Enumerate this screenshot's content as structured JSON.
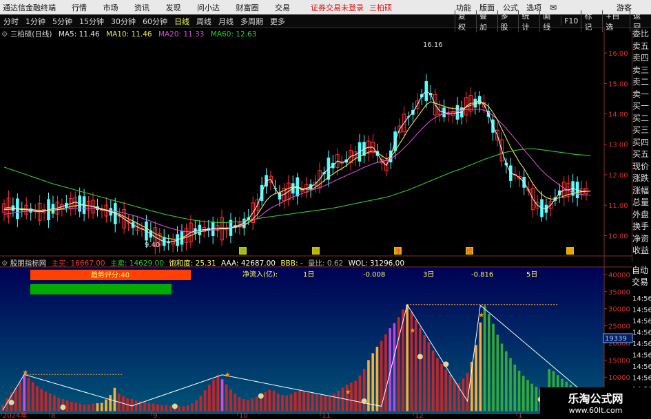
{
  "titlebar": {
    "app": "通达信金融终端",
    "menu": [
      "行情",
      "市场",
      "资讯",
      "发现",
      "问小达",
      "财富圈",
      "交易"
    ],
    "warn": "证券交易未登录",
    "stock_name": "三柏硕",
    "rmenu": [
      "功能",
      "版面",
      "公式",
      "选项"
    ],
    "guest": "游客"
  },
  "toolbar": {
    "periods": [
      "分时",
      "1分钟",
      "5分钟",
      "15分钟",
      "30分钟",
      "60分钟",
      "日线",
      "周线",
      "月线",
      "多周期",
      "更多"
    ],
    "active": "日线",
    "right": [
      "复权",
      "叠加",
      "多股",
      "统计",
      "画线",
      "F10",
      "标记",
      "+自选",
      "返回"
    ]
  },
  "legend_main": {
    "name": "三柏硕(日线)",
    "ma": [
      {
        "label": "MA5: 11.46",
        "color": "#e8e8e8"
      },
      {
        "label": "MA10: 11.46",
        "color": "#e8e85a"
      },
      {
        "label": "MA20: 11.33",
        "color": "#d84fd8"
      },
      {
        "label": "MA60: 12.63",
        "color": "#33cc33"
      }
    ]
  },
  "legend_sub": {
    "name": "股朋指标网",
    "items": [
      {
        "label": "主买: 16667.00",
        "color": "#ff3333"
      },
      {
        "label": "主卖: 14629.00",
        "color": "#33cc33"
      },
      {
        "label": "饱和度: 25.31",
        "color": "#ffff66"
      },
      {
        "label": "AAA: 42687.00",
        "color": "#ffffff"
      },
      {
        "label": "BBB: -",
        "color": "#ffff66"
      },
      {
        "label": "量比: 0.62",
        "color": "#aaaaaa"
      },
      {
        "label": "WOL: 31296.00",
        "color": "#ffffff"
      }
    ]
  },
  "sub_info": {
    "score": "趋势评分:40",
    "netflow": "净流入(亿):",
    "d1": "1日",
    "v1": "-0.008",
    "d3": "3日",
    "v3": "-0.816",
    "d5": "5日",
    "current": "19339"
  },
  "right_panel": [
    "委比",
    "卖五",
    "卖四",
    "卖三",
    "卖二",
    "卖一",
    "买一",
    "买二",
    "买三",
    "买四",
    "买五",
    "现价",
    "涨跌",
    "涨幅",
    "总量",
    "外盘",
    "换手",
    "净资",
    "收益"
  ],
  "auto_panel": [
    "自动",
    "交易"
  ],
  "right_times": [
    "14:56",
    "14:56",
    "14:56",
    "14:56",
    "14:56",
    "14:56",
    "14:56",
    "14:56",
    "14:56",
    "14:56"
  ],
  "events": [
    "跌",
    "财",
    "涨",
    "榜",
    "跌"
  ],
  "watermark": {
    "name": "乐淘公式网",
    "url": "www.60lt.com"
  },
  "chart_data": [
    {
      "type": "candlestick",
      "ylim": [
        9.6,
        16.5
      ],
      "ticks": [
        "16.00",
        "15.00",
        "14.00",
        "13.00",
        "12.00",
        "11.00",
        "10.00"
      ],
      "annotations": [
        "16.16",
        "9.40"
      ],
      "xlabels": [
        "2024年",
        "8",
        "9",
        "10",
        "11",
        "12",
        "1"
      ],
      "ma5": [
        10.9,
        10.92,
        10.9,
        10.88,
        10.85,
        10.85,
        10.82,
        10.8,
        10.78,
        10.8,
        10.85,
        10.88,
        10.9,
        10.95,
        11.0,
        11.05,
        11.1,
        11.05,
        11.0,
        10.98,
        10.95,
        10.9,
        10.85,
        10.82,
        10.78,
        10.72,
        10.65,
        10.55,
        10.45,
        10.35,
        10.28,
        10.22,
        10.15,
        10.05,
        9.95,
        9.87,
        9.8,
        9.78,
        9.8,
        9.85,
        9.92,
        10.0,
        10.1,
        10.15,
        10.18,
        10.2,
        10.2,
        10.22,
        10.24,
        10.22,
        10.22,
        10.25,
        10.3,
        10.35,
        10.4,
        10.55,
        10.75,
        11.0,
        11.4,
        11.8,
        11.85,
        11.55,
        11.3,
        11.35,
        11.45,
        11.55,
        11.6,
        11.5,
        11.55,
        11.6,
        11.7,
        11.85,
        12.05,
        12.2,
        12.3,
        12.45,
        12.4,
        12.45,
        12.6,
        12.65,
        12.75,
        12.85,
        12.9,
        12.9,
        12.7,
        12.45,
        12.3,
        12.6,
        13.1,
        13.5,
        13.7,
        13.9,
        14.05,
        14.3,
        14.6,
        14.75,
        14.65,
        14.3,
        14.1,
        14.05,
        14.0,
        14.0,
        14.05,
        14.05,
        14.25,
        14.35,
        14.35,
        14.45,
        14.3,
        14.0,
        13.6,
        13.3,
        12.8,
        12.35,
        12.05,
        12.0,
        11.9,
        11.75,
        11.5,
        11.2,
        11.0,
        10.9,
        10.88,
        11.0,
        11.2,
        11.4,
        11.5,
        11.5,
        11.55,
        11.5,
        11.45,
        11.46
      ],
      "ma10": [
        10.85,
        10.86,
        10.87,
        10.88,
        10.88,
        10.87,
        10.86,
        10.84,
        10.83,
        10.82,
        10.82,
        10.83,
        10.85,
        10.88,
        10.92,
        10.95,
        10.98,
        11.0,
        11.0,
        10.98,
        10.96,
        10.92,
        10.88,
        10.84,
        10.8,
        10.75,
        10.7,
        10.62,
        10.55,
        10.48,
        10.4,
        10.32,
        10.25,
        10.15,
        10.06,
        9.99,
        9.93,
        9.9,
        9.88,
        9.88,
        9.9,
        9.94,
        10.0,
        10.06,
        10.12,
        10.16,
        10.2,
        10.23,
        10.24,
        10.25,
        10.24,
        10.25,
        10.27,
        10.3,
        10.34,
        10.42,
        10.55,
        10.7,
        10.92,
        11.15,
        11.3,
        11.38,
        11.42,
        11.48,
        11.55,
        11.6,
        11.6,
        11.55,
        11.52,
        11.52,
        11.58,
        11.68,
        11.8,
        11.92,
        12.02,
        12.12,
        12.2,
        12.3,
        12.42,
        12.52,
        12.6,
        12.68,
        12.74,
        12.78,
        12.72,
        12.62,
        12.52,
        12.58,
        12.78,
        13.02,
        13.25,
        13.5,
        13.7,
        13.9,
        14.1,
        14.3,
        14.4,
        14.35,
        14.3,
        14.25,
        14.2,
        14.18,
        14.17,
        14.15,
        14.22,
        14.28,
        14.32,
        14.38,
        14.35,
        14.25,
        14.05,
        13.8,
        13.5,
        13.2,
        12.9,
        12.65,
        12.4,
        12.2,
        11.95,
        11.7,
        11.5,
        11.35,
        11.25,
        11.2,
        11.2,
        11.25,
        11.3,
        11.35,
        11.38,
        11.42,
        11.44,
        11.45,
        11.46
      ],
      "ma20": [
        10.7,
        10.72,
        10.74,
        10.76,
        10.78,
        10.8,
        10.8,
        10.81,
        10.82,
        10.82,
        10.83,
        10.84,
        10.85,
        10.86,
        10.87,
        10.88,
        10.89,
        10.9,
        10.9,
        10.9,
        10.9,
        10.88,
        10.86,
        10.84,
        10.82,
        10.8,
        10.77,
        10.74,
        10.7,
        10.66,
        10.62,
        10.57,
        10.52,
        10.47,
        10.41,
        10.36,
        10.31,
        10.26,
        10.22,
        10.18,
        10.15,
        10.13,
        10.12,
        10.12,
        10.13,
        10.14,
        10.16,
        10.18,
        10.2,
        10.22,
        10.24,
        10.27,
        10.3,
        10.33,
        10.37,
        10.43,
        10.5,
        10.58,
        10.68,
        10.8,
        10.9,
        10.98,
        11.05,
        11.12,
        11.2,
        11.27,
        11.33,
        11.38,
        11.43,
        11.48,
        11.53,
        11.58,
        11.63,
        11.7,
        11.77,
        11.84,
        11.9,
        11.97,
        12.04,
        12.1,
        12.17,
        12.24,
        12.3,
        12.36,
        12.4,
        12.44,
        12.48,
        12.53,
        12.62,
        12.74,
        12.88,
        13.02,
        13.18,
        13.35,
        13.5,
        13.65,
        13.78,
        13.88,
        13.95,
        14.0,
        14.05,
        14.08,
        14.1,
        14.12,
        14.14,
        14.15,
        14.15,
        14.15,
        14.12,
        14.05,
        13.95,
        13.82,
        13.68,
        13.52,
        13.35,
        13.18,
        13.0,
        12.82,
        12.65,
        12.48,
        12.3,
        12.14,
        12.0,
        11.88,
        11.77,
        11.66,
        11.56,
        11.48,
        11.42,
        11.37,
        11.34,
        11.33,
        11.33
      ],
      "ma60": [
        12.25,
        12.2,
        12.15,
        12.1,
        12.05,
        12.0,
        11.95,
        11.9,
        11.85,
        11.8,
        11.75,
        11.7,
        11.66,
        11.62,
        11.58,
        11.54,
        11.5,
        11.46,
        11.42,
        11.38,
        11.34,
        11.3,
        11.26,
        11.22,
        11.18,
        11.14,
        11.1,
        11.06,
        11.02,
        10.98,
        10.94,
        10.9,
        10.86,
        10.82,
        10.78,
        10.74,
        10.7,
        10.67,
        10.64,
        10.61,
        10.58,
        10.55,
        10.52,
        10.5,
        10.48,
        10.46,
        10.45,
        10.44,
        10.43,
        10.43,
        10.43,
        10.44,
        10.45,
        10.46,
        10.48,
        10.5,
        10.52,
        10.55,
        10.58,
        10.6,
        10.62,
        10.64,
        10.66,
        10.68,
        10.7,
        10.72,
        10.74,
        10.76,
        10.78,
        10.8,
        10.82,
        10.84,
        10.86,
        10.88,
        10.9,
        10.93,
        10.96,
        10.99,
        11.02,
        11.05,
        11.08,
        11.11,
        11.14,
        11.17,
        11.2,
        11.23,
        11.26,
        11.3,
        11.35,
        11.4,
        11.45,
        11.5,
        11.56,
        11.62,
        11.68,
        11.74,
        11.8,
        11.86,
        11.92,
        11.98,
        12.04,
        12.1,
        12.15,
        12.2,
        12.26,
        12.32,
        12.38,
        12.44,
        12.5,
        12.55,
        12.6,
        12.65,
        12.7,
        12.74,
        12.77,
        12.8,
        12.82,
        12.84,
        12.85,
        12.85,
        12.84,
        12.82,
        12.8,
        12.78,
        12.76,
        12.74,
        12.72,
        12.7,
        12.68,
        12.66,
        12.65,
        12.64,
        12.63
      ]
    },
    {
      "type": "bar",
      "ylim": [
        0,
        42000
      ],
      "ticks": [
        "40000",
        "35000",
        "30000",
        "25000",
        "20000",
        "15000",
        "10000",
        "5000"
      ],
      "values": [
        2000,
        3800,
        5500,
        7000,
        8500,
        10800,
        9800,
        8600,
        7400,
        6600,
        5800,
        5200,
        4600,
        4000,
        3600,
        3200,
        2800,
        2600,
        2200,
        2000,
        2100,
        2300,
        2400,
        2500,
        3500,
        4800,
        6900,
        5200,
        4500,
        3800,
        3600,
        3200,
        3000,
        2700,
        2500,
        2300,
        2100,
        1900,
        1800,
        1700,
        1600,
        1500,
        1500,
        1800,
        2400,
        3300,
        4600,
        6200,
        7800,
        9300,
        10700,
        9400,
        7900,
        6500,
        5200,
        4200,
        3600,
        3400,
        3800,
        4300,
        4900,
        5600,
        6300,
        6100,
        5200,
        4800,
        4700,
        5000,
        5600,
        6400,
        6000,
        5800,
        5400,
        5000,
        4800,
        4600,
        4400,
        5200,
        6000,
        7000,
        7800,
        8400,
        9000,
        10500,
        12400,
        15000,
        17000,
        18900,
        20600,
        22500,
        24300,
        25800,
        27500,
        29800,
        31200,
        29000,
        26700,
        24500,
        22300,
        20200,
        17800,
        15600,
        13900,
        12200,
        10700,
        9300,
        8200,
        9600,
        11300,
        14500,
        19400,
        26000,
        31000,
        28500,
        25600,
        22400,
        19800,
        17600,
        15600,
        13700,
        11900,
        10400,
        9200,
        8100,
        7200,
        6500,
        5800,
        12400,
        11800,
        10600,
        9500,
        8700,
        7800,
        7200,
        6600
      ]
    }
  ]
}
